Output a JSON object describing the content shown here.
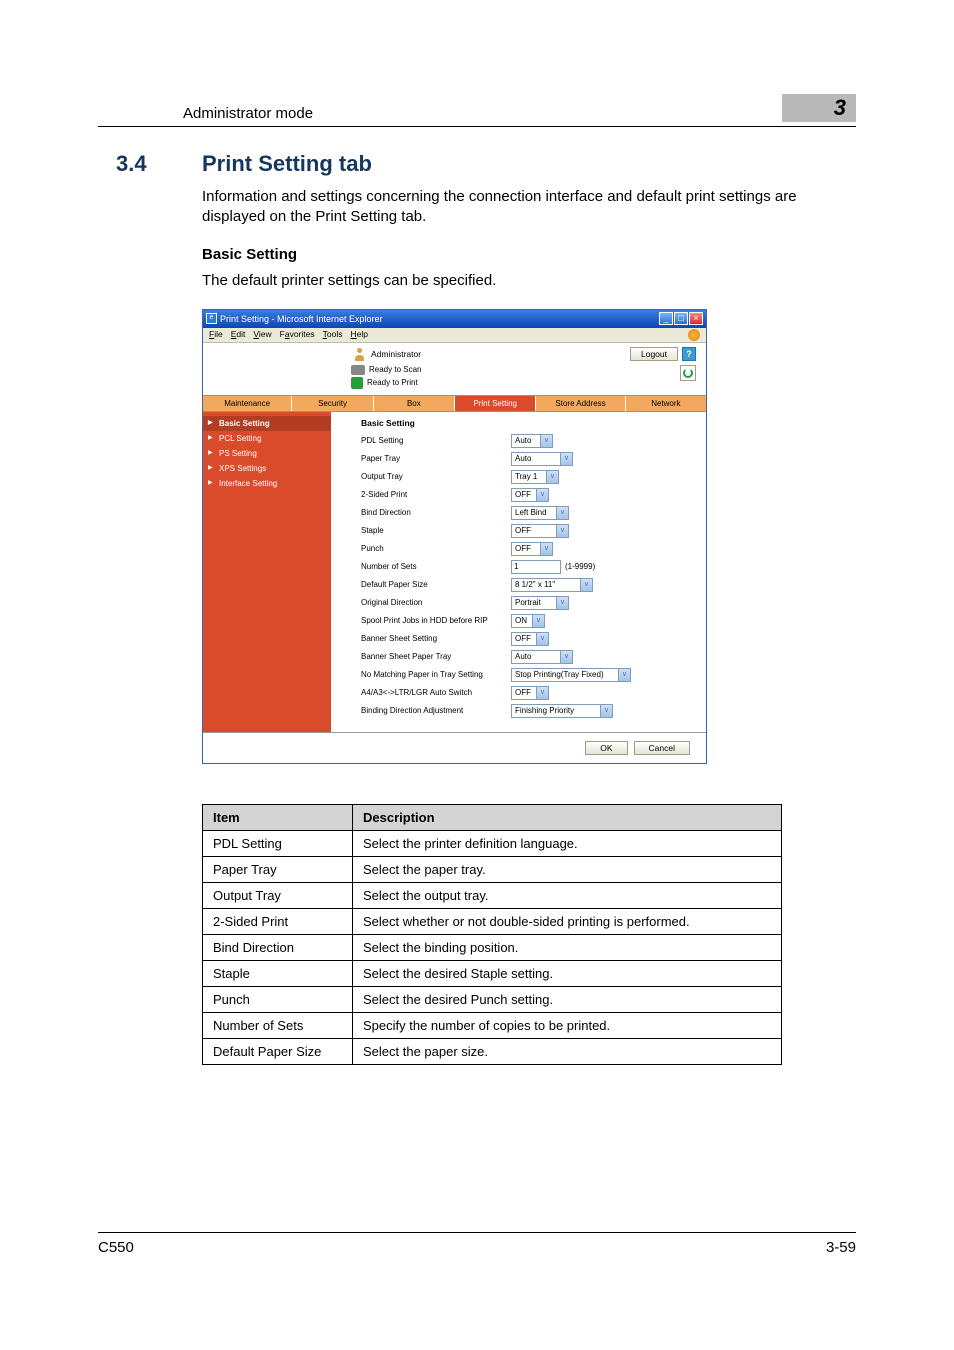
{
  "header": {
    "breadcrumb": "Administrator mode",
    "chapter_no": "3"
  },
  "section": {
    "number": "3.4",
    "title": "Print Setting tab",
    "intro": "Information and settings concerning the connection interface and default print settings are displayed on the Print Setting tab.",
    "sub_heading": "Basic Setting",
    "sub_text": "The default printer settings can be specified."
  },
  "browser": {
    "ie_icon": "e",
    "window_title": "Print Setting - Microsoft Internet Explorer",
    "min": "_",
    "max": "□",
    "close": "×",
    "menu": {
      "file": "File",
      "edit": "Edit",
      "view": "View",
      "fav": "Favorites",
      "tools": "Tools",
      "help": "Help"
    }
  },
  "app": {
    "admin_label": "Administrator",
    "logout": "Logout",
    "help": "?",
    "status_scan": "Ready to Scan",
    "status_print": "Ready to Print",
    "tabs": {
      "maintenance": "Maintenance",
      "security": "Security",
      "box": "Box",
      "print_setting": "Print Setting",
      "store_address": "Store Address",
      "network": "Network"
    },
    "sidebar": {
      "basic": "Basic Setting",
      "pcl": "PCL Setting",
      "ps": "PS Setting",
      "xps": "XPS Settings",
      "interface": "Interface Setting"
    },
    "form_title": "Basic Setting",
    "fields": {
      "pdl": {
        "label": "PDL Setting",
        "value": "Auto"
      },
      "paper_tray": {
        "label": "Paper Tray",
        "value": "Auto"
      },
      "output_tray": {
        "label": "Output Tray",
        "value": "Tray 1"
      },
      "two_sided": {
        "label": "2-Sided Print",
        "value": "OFF"
      },
      "bind_dir": {
        "label": "Bind Direction",
        "value": "Left Bind"
      },
      "staple": {
        "label": "Staple",
        "value": "OFF"
      },
      "punch": {
        "label": "Punch",
        "value": "OFF"
      },
      "num_sets": {
        "label": "Number of Sets",
        "value": "1",
        "hint": "(1-9999)"
      },
      "def_paper": {
        "label": "Default Paper Size",
        "value": "8 1/2\" x 11\""
      },
      "orig_dir": {
        "label": "Original Direction",
        "value": "Portrait"
      },
      "spool": {
        "label": "Spool Print Jobs in HDD before RIP",
        "value": "ON"
      },
      "banner_setting": {
        "label": "Banner Sheet Setting",
        "value": "OFF"
      },
      "banner_tray": {
        "label": "Banner Sheet Paper Tray",
        "value": "Auto"
      },
      "no_match": {
        "label": "No Matching Paper in Tray Setting",
        "value": "Stop Printing(Tray Fixed)"
      },
      "auto_switch": {
        "label": "A4/A3<->LTR/LGR Auto Switch",
        "value": "OFF"
      },
      "binding_adj": {
        "label": "Binding Direction Adjustment",
        "value": "Finishing Priority"
      }
    },
    "ok": "OK",
    "cancel": "Cancel"
  },
  "table": {
    "head_item": "Item",
    "head_desc": "Description",
    "rows": [
      {
        "item": "PDL Setting",
        "desc": "Select the printer definition language."
      },
      {
        "item": "Paper Tray",
        "desc": "Select the paper tray."
      },
      {
        "item": "Output Tray",
        "desc": "Select the output tray."
      },
      {
        "item": "2-Sided Print",
        "desc": "Select whether or not double-sided printing is performed."
      },
      {
        "item": "Bind Direction",
        "desc": "Select the binding position."
      },
      {
        "item": "Staple",
        "desc": "Select the desired Staple setting."
      },
      {
        "item": "Punch",
        "desc": "Select the desired Punch setting."
      },
      {
        "item": "Number of Sets",
        "desc": "Specify the number of copies to be printed."
      },
      {
        "item": "Default Paper Size",
        "desc": "Select the paper size."
      }
    ]
  },
  "footer": {
    "model": "C550",
    "page": "3-59"
  }
}
